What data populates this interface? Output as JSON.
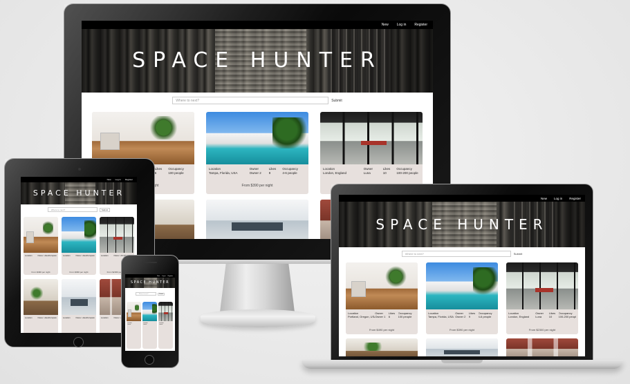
{
  "nav": {
    "new": "New",
    "login": "Log in",
    "register": "Register"
  },
  "brand": {
    "title": "SPACE HUNTER"
  },
  "search": {
    "placeholder": "Where to next?",
    "submit": "Submit"
  },
  "labels": {
    "location": "Location",
    "owner": "Owner",
    "likes": "Likes",
    "occupancy": "Occupancy"
  },
  "listings": [
    {
      "location": "Portland, Oregon, USA",
      "owner": "Owner 1",
      "likes": "6",
      "occupancy": "100 people",
      "price": "From $490 per night"
    },
    {
      "location": "Tampa, Florida, USA",
      "owner": "Owner 2",
      "likes": "9",
      "occupancy": "4-6 people",
      "price": "From $390 per night"
    },
    {
      "location": "London, England",
      "owner": "Luna",
      "likes": "10",
      "occupancy": "100-200 people",
      "price": "From $2300 per night"
    }
  ],
  "colors": {
    "card_bg": "#e7e0dd",
    "nav_bg": "#000000",
    "bezel": "#111111"
  }
}
